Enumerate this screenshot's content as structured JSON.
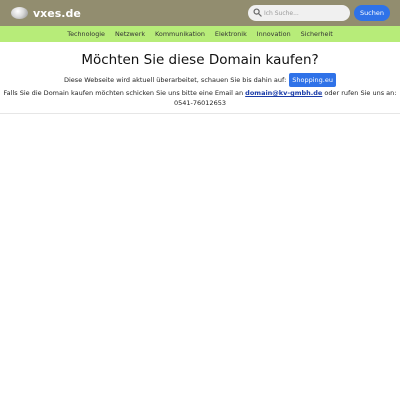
{
  "header": {
    "logo_text": "vxes.de",
    "logo_icon": "globe-icon",
    "search": {
      "placeholder": "Ich Suche...",
      "value": "",
      "button_label": "Suchen"
    },
    "colors": {
      "header_bg": "#928d6f",
      "accent": "#2f72e8"
    }
  },
  "nav": {
    "items": [
      {
        "label": "Technologie"
      },
      {
        "label": "Netzwerk"
      },
      {
        "label": "Kommunikation"
      },
      {
        "label": "Elektronik"
      },
      {
        "label": "Innovation"
      },
      {
        "label": "Sicherheit"
      }
    ],
    "bg_color": "#b7ec79"
  },
  "main": {
    "headline": "Möchten Sie diese Domain kaufen?",
    "line1_text": "Diese Webseite wird aktuell überarbeitet, schauen Sie bis dahin auf:",
    "shop_button_label": "Shopping.eu",
    "line2_prefix": "Falls Sie die Domain kaufen möchten schicken Sie uns bitte eine Email an",
    "email": "domain@kv-gmbh.de",
    "line2_suffix": "oder rufen Sie uns an: 0541-76012653"
  }
}
